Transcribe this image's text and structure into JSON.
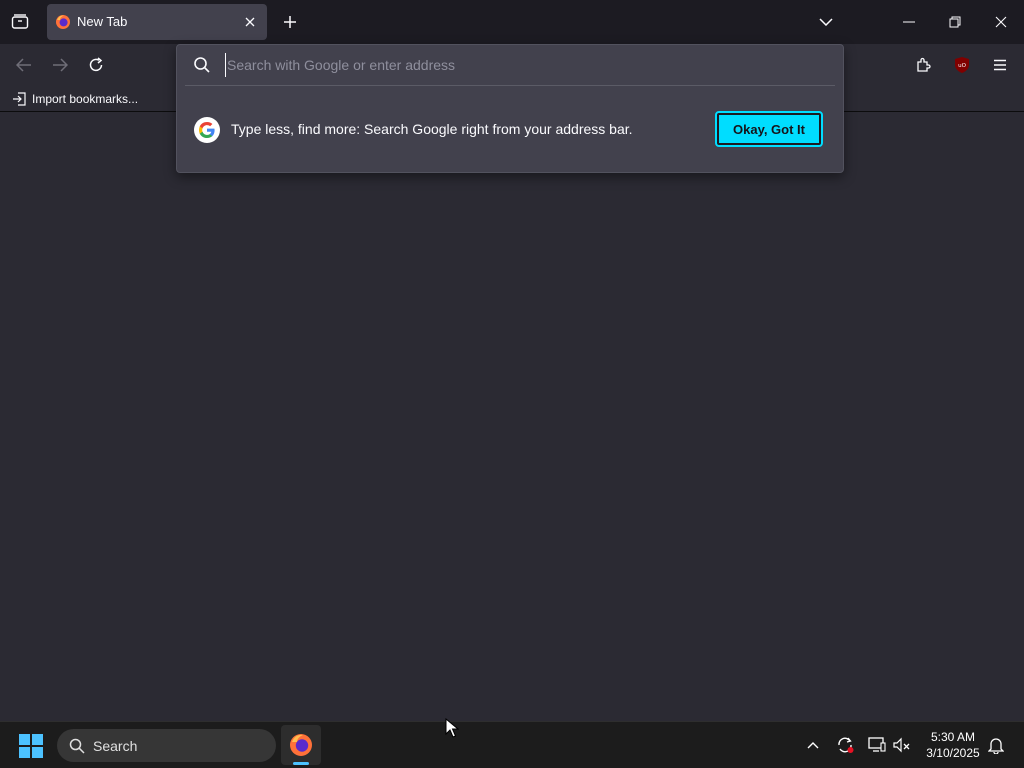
{
  "browser": {
    "tab": {
      "title": "New Tab"
    },
    "bookmarks_toolbar": {
      "import_label": "Import bookmarks..."
    },
    "urlbar": {
      "placeholder": "Search with Google or enter address",
      "value": ""
    },
    "tip": {
      "text": "Type less, find more: Search Google right from your address bar.",
      "button_label": "Okay, Got It"
    },
    "icons": [
      "tab-overview-icon",
      "firefox-icon",
      "close-icon",
      "plus-icon",
      "chevron-down-icon",
      "minimize-icon",
      "restore-icon",
      "back-icon",
      "forward-icon",
      "reload-icon",
      "search-icon",
      "extensions-icon",
      "ublock-icon",
      "menu-icon",
      "import-icon",
      "google-icon"
    ],
    "colors": {
      "accent": "#00ddff",
      "toolbar": "#2b2a33",
      "tabstrip": "#1c1b22",
      "popup": "#42414d"
    }
  },
  "taskbar": {
    "search_label": "Search",
    "clock": {
      "time": "5:30 AM",
      "date": "3/10/2025"
    }
  }
}
